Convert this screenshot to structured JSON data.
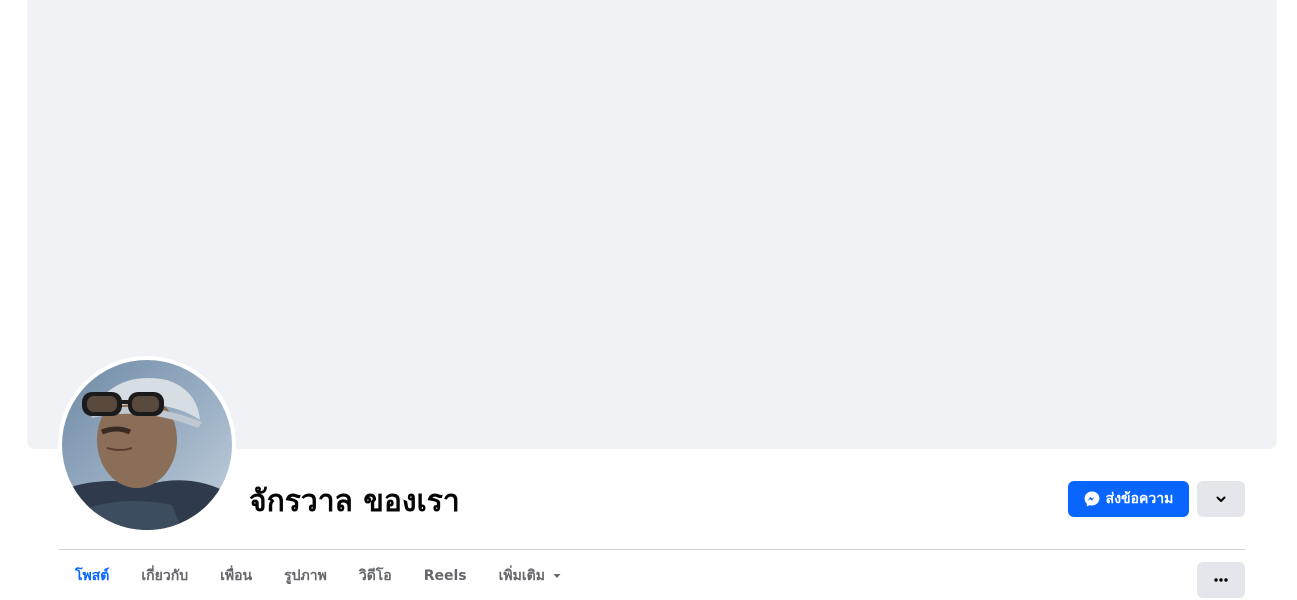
{
  "profile": {
    "name": "จักรวาล ของเรา"
  },
  "actions": {
    "message_label": "ส่งข้อความ",
    "message_icon": "messenger-icon",
    "dropdown_icon": "chevron-down-icon",
    "more_icon": "ellipsis-icon"
  },
  "tabs": [
    {
      "label": "โพสต์",
      "active": true
    },
    {
      "label": "เกี่ยวกับ",
      "active": false
    },
    {
      "label": "เพื่อน",
      "active": false
    },
    {
      "label": "รูปภาพ",
      "active": false
    },
    {
      "label": "วิดีโอ",
      "active": false
    },
    {
      "label": "Reels",
      "active": false
    },
    {
      "label": "เพิ่มเติม",
      "active": false
    }
  ],
  "colors": {
    "accent": "#0866ff",
    "cover_background": "#f0f2f5",
    "secondary_button": "#e4e6eb",
    "tab_text": "#65676b"
  }
}
